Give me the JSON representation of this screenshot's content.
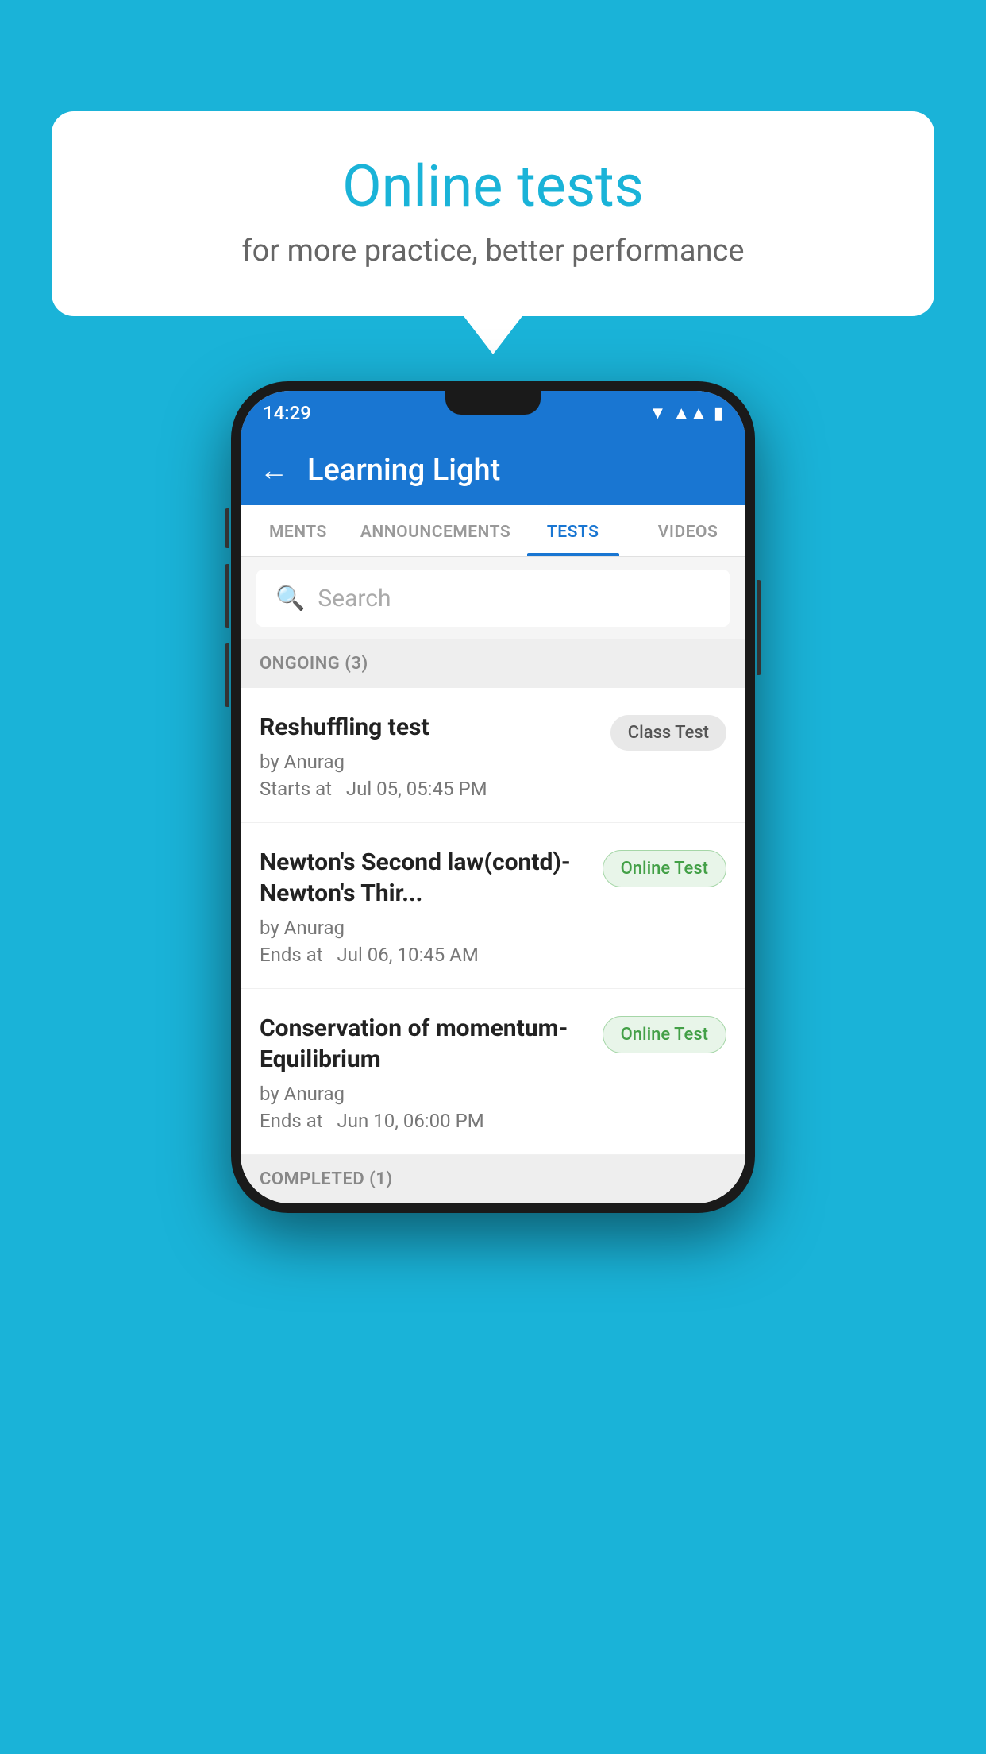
{
  "background": {
    "color": "#1ab3d8"
  },
  "speech_bubble": {
    "title": "Online tests",
    "subtitle": "for more practice, better performance"
  },
  "phone": {
    "status_bar": {
      "time": "14:29",
      "icons": [
        "wifi",
        "signal",
        "battery"
      ]
    },
    "app_bar": {
      "title": "Learning Light",
      "back_label": "←"
    },
    "tabs": [
      {
        "label": "MENTS",
        "active": false
      },
      {
        "label": "ANNOUNCEMENTS",
        "active": false
      },
      {
        "label": "TESTS",
        "active": true
      },
      {
        "label": "VIDEOS",
        "active": false
      }
    ],
    "search": {
      "placeholder": "Search"
    },
    "ongoing_section": {
      "label": "ONGOING (3)"
    },
    "test_items": [
      {
        "title": "Reshuffling test",
        "author": "by Anurag",
        "time_label": "Starts at",
        "time_value": "Jul 05, 05:45 PM",
        "badge": "Class Test",
        "badge_type": "class"
      },
      {
        "title": "Newton's Second law(contd)-Newton's Thir...",
        "author": "by Anurag",
        "time_label": "Ends at",
        "time_value": "Jul 06, 10:45 AM",
        "badge": "Online Test",
        "badge_type": "online"
      },
      {
        "title": "Conservation of momentum-Equilibrium",
        "author": "by Anurag",
        "time_label": "Ends at",
        "time_value": "Jun 10, 06:00 PM",
        "badge": "Online Test",
        "badge_type": "online"
      }
    ],
    "completed_section": {
      "label": "COMPLETED (1)"
    }
  }
}
